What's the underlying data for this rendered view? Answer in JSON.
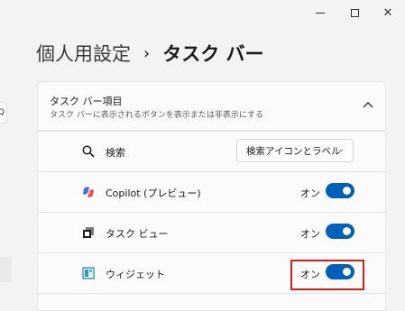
{
  "window": {
    "minimize_glyph": "",
    "maximize_glyph": "",
    "close_glyph": "✕"
  },
  "sidebar": {
    "search_glyph": "Q"
  },
  "breadcrumb": {
    "parent": "個人用設定",
    "separator": "›",
    "current": "タスク バー"
  },
  "section": {
    "title": "タスク バー項目",
    "description": "タスク バーに表示されるボタンを表示または非表示にする",
    "chevron": "^"
  },
  "items": [
    {
      "icon": "search-icon",
      "label": "検索",
      "control": "dropdown",
      "value": "検索アイコンとラベル",
      "chevron": "⌄"
    },
    {
      "icon": "copilot-icon",
      "label": "Copilot (プレビュー)",
      "control": "toggle",
      "state_text": "オン",
      "on": true
    },
    {
      "icon": "task-view-icon",
      "label": "タスク ビュー",
      "control": "toggle",
      "state_text": "オン",
      "on": true
    },
    {
      "icon": "widgets-icon",
      "label": "ウィジェット",
      "control": "toggle",
      "state_text": "オン",
      "on": true,
      "highlighted": true
    }
  ],
  "colors": {
    "accent": "#005fb8",
    "highlight": "#d91f1f",
    "background": "#f3f3f3",
    "card": "#fbfbfb"
  }
}
